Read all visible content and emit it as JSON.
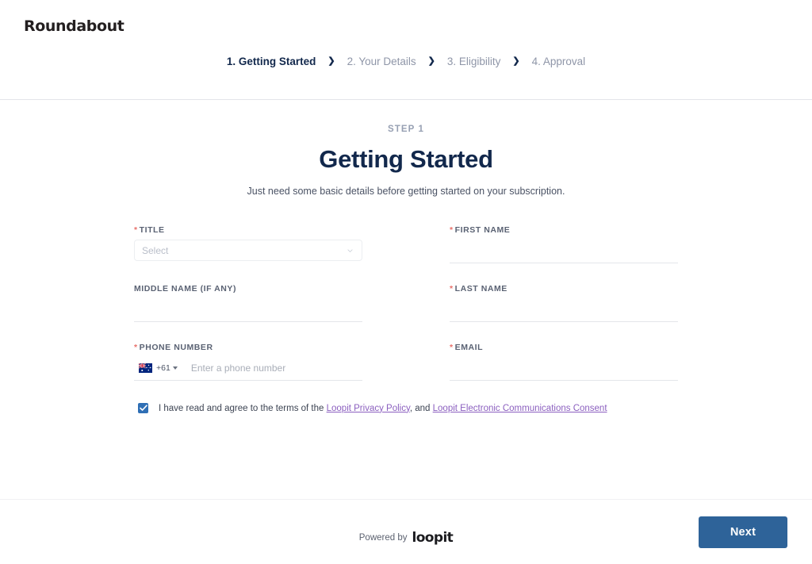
{
  "header": {
    "brand": "Roundabout",
    "steps": [
      {
        "label": "1. Getting Started",
        "active": true
      },
      {
        "label": "2. Your Details",
        "active": false
      },
      {
        "label": "3. Eligibility",
        "active": false
      },
      {
        "label": "4. Approval",
        "active": false
      }
    ],
    "separator": "❯"
  },
  "main": {
    "step_label": "STEP 1",
    "title": "Getting Started",
    "subtitle": "Just need some basic details before getting started on your subscription."
  },
  "form": {
    "fields": [
      {
        "name": "title",
        "label": "TITLE",
        "required": true,
        "type": "select",
        "placeholder": "Select",
        "value": ""
      },
      {
        "name": "first-name",
        "label": "FIRST NAME",
        "required": true,
        "type": "text",
        "placeholder": "",
        "value": ""
      },
      {
        "name": "middle-name",
        "label": "MIDDLE NAME (IF ANY)",
        "required": false,
        "type": "text",
        "placeholder": "",
        "value": ""
      },
      {
        "name": "last-name",
        "label": "LAST NAME",
        "required": true,
        "type": "text",
        "placeholder": "",
        "value": ""
      },
      {
        "name": "phone-number",
        "label": "PHONE NUMBER",
        "required": true,
        "type": "phone",
        "placeholder": "Enter a phone number",
        "value": "",
        "dial_code": "+61",
        "country_flag": "australia-flag-icon"
      },
      {
        "name": "email",
        "label": "EMAIL",
        "required": true,
        "type": "text",
        "placeholder": "",
        "value": ""
      }
    ],
    "required_marker": "*"
  },
  "consent": {
    "checked": true,
    "text_before": "I have read and agree to the terms of the ",
    "link1": "Loopit Privacy Policy",
    "text_middle": ", and ",
    "link2": "Loopit Electronic Communications Consent"
  },
  "footer": {
    "powered_by": "Powered by",
    "powered_brand": "loopit",
    "next_label": "Next"
  },
  "colors": {
    "accent_button": "#2e6399",
    "heading_navy": "#12284c",
    "required_red": "#e8716b",
    "link_purple": "#8b5fbf",
    "checkbox_blue": "#2f6fb5",
    "step_inactive": "#8f96a8"
  }
}
